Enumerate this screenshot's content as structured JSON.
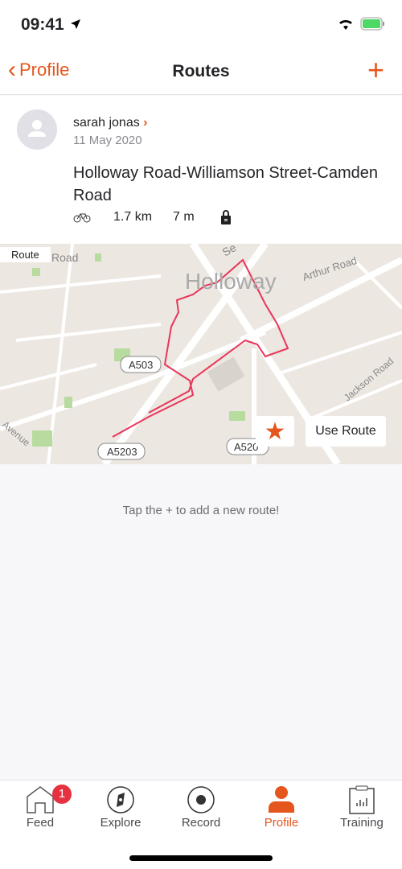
{
  "status_bar": {
    "time": "09:41"
  },
  "nav": {
    "back_label": "Profile",
    "title": "Routes",
    "add_icon": "plus-icon"
  },
  "route": {
    "athlete": "sarah jonas",
    "date": "11 May 2020",
    "title": "Holloway Road-Williamson Street-Camden Road",
    "sport_icon": "bike-icon",
    "distance": "1.7 km",
    "elevation": "7 m",
    "privacy_icon": "lock-icon",
    "map": {
      "tag": "Route",
      "labels": [
        "Road",
        "Se",
        "Holloway",
        "Arthur Road",
        "A503",
        "Jackson Road",
        "A5203",
        "A520",
        "Avenue"
      ]
    },
    "use_route_label": "Use Route"
  },
  "empty_hint": "Tap the + to add a new route!",
  "tabs": [
    {
      "label": "Feed",
      "badge": "1"
    },
    {
      "label": "Explore"
    },
    {
      "label": "Record"
    },
    {
      "label": "Profile",
      "active": true
    },
    {
      "label": "Training"
    }
  ],
  "colors": {
    "accent": "#e5561e",
    "route_line": "#e8365a",
    "badge": "#e53140"
  }
}
